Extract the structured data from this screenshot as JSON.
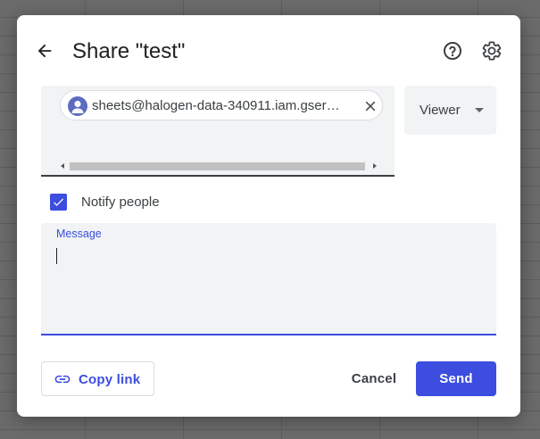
{
  "dialog": {
    "title": "Share \"test\""
  },
  "header_icons": {
    "back": "arrow-back-icon",
    "help": "help-circle-icon",
    "settings": "gear-icon"
  },
  "recipients": {
    "chips": [
      {
        "label": "sheets@halogen-data-340911.iam.gser…",
        "avatar": "person-avatar-icon",
        "remove_icon": "close-icon"
      }
    ]
  },
  "role": {
    "selected": "Viewer"
  },
  "notify": {
    "label": "Notify people",
    "checked": true
  },
  "message": {
    "label": "Message",
    "value": ""
  },
  "footer": {
    "copy_link_label": "Copy link",
    "cancel_label": "Cancel",
    "send_label": "Send"
  },
  "colors": {
    "accent": "#3c4de0",
    "field_bg": "#f1f3f4",
    "text": "#3c4043"
  }
}
